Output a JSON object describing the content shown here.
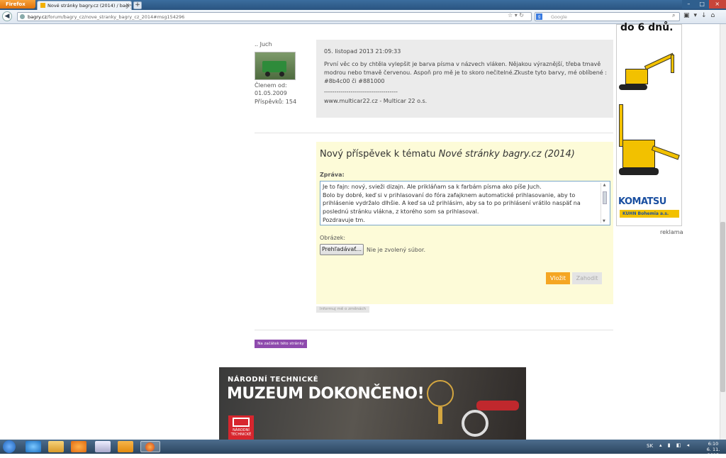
{
  "browser": {
    "menu_button": "Firefox",
    "tab_title": "Nové stránky bagry.cz (2014) / bagry.cz /...",
    "tab_close": "×",
    "new_tab": "+",
    "url_domain": "bagry.cz",
    "url_path": "/forum/bagry_cz/nove_stranky_bagry_cz_2014#msg154296",
    "search_engine": "g",
    "search_placeholder": "Google",
    "window_controls": {
      "minimize": "–",
      "maximize": "□",
      "close": "×"
    }
  },
  "post": {
    "author": ".. Juch",
    "member_since_label": "Členem od:",
    "member_since": "01.05.2009",
    "posts_count": "Příspěvků: 154",
    "date": "05. listopad 2013 21:09:33",
    "text": "První věc co by chtěla vylepšit je barva písma v názvech vláken. Nějakou výraznější, třeba tmavě modrou nebo tmavě červenou. Aspoň pro mě je to skoro nečitelné.Zkuste tyto barvy, mé oblíbené : #8b4c00 či #881000",
    "separator": "------------------------------------",
    "signature": "www.multicar22.cz - Multicar 22 o.s."
  },
  "reply": {
    "title_prefix": "Nový příspěvek k tématu ",
    "title_topic": "Nové stránky bagry.cz (2014)",
    "message_label": "Zpráva:",
    "message_value": "Je to fajn: nový, svieži dizajn. Ale prikláňam sa k farbám písma ako píše Juch.\nBolo by dobré, keď si v prihlasovaní do fóra zafajknem automatické prihlasovanie, aby to prihlásenie vydržalo dlhšie. A keď sa už prihlásim, aby sa to po prihlásení vrátilo naspäť na poslednú stránku vlákna, z ktorého som sa prihlasoval.\nPozdravuje tm.",
    "image_label": "Obrázek:",
    "browse_button": "Prehľadávať...",
    "no_file": "Nie je zvolený súbor.",
    "submit_button": "Vložit",
    "discard_button": "Zahodit"
  },
  "notify_button": "Informuj mě o změnách",
  "top_link": "Na začátek této stránky",
  "ad": {
    "headline": "do 6 dnů.",
    "brand": "KOMATSU",
    "dealer": "KUHN Bohemia a.s.",
    "label": "reklama"
  },
  "banner": {
    "line1": "NÁRODNÍ TECHNICKÉ",
    "line2": "MUZEUM DOKONČENO!",
    "logo_text": "NÁRODNÍ TECHNICKÉ"
  },
  "taskbar": {
    "language": "SK",
    "time": "6:10",
    "date": "6. 11. 2013"
  },
  "colors": {
    "accent_orange": "#f5a623",
    "reply_background": "#fdfbd8",
    "post_background": "#ebebeb",
    "top_link_purple": "#8e4aad"
  }
}
